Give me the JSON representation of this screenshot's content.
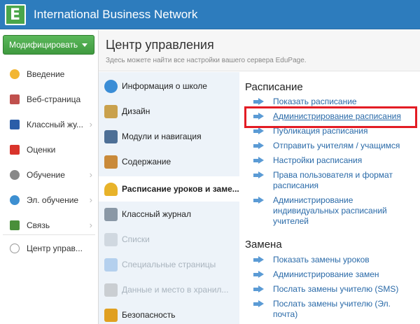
{
  "app": {
    "logo_letter": "E",
    "title": "International Business Network"
  },
  "sidebar": {
    "modify_button": "Модифицировать",
    "items": [
      {
        "label": "Введение",
        "icon": "star-icon",
        "has_submenu": false
      },
      {
        "label": "Веб-страница",
        "icon": "house-icon",
        "has_submenu": false
      },
      {
        "label": "Классный жу...",
        "icon": "journal-icon",
        "has_submenu": true
      },
      {
        "label": "Оценки",
        "icon": "grades-icon",
        "has_submenu": false
      },
      {
        "label": "Обучение",
        "icon": "gear-icon",
        "has_submenu": true
      },
      {
        "label": "Эл. обучение",
        "icon": "globe-icon",
        "has_submenu": true
      },
      {
        "label": "Связь",
        "icon": "envelope-icon",
        "has_submenu": true
      },
      {
        "label": "Центр управ...",
        "icon": "control-center-icon",
        "has_submenu": false
      }
    ]
  },
  "header": {
    "title": "Центр управления",
    "subtitle": "Здесь можете найти все настройки вашего сервера EduPage."
  },
  "categories": [
    {
      "label": "Информация о школе",
      "icon": "globe-info-icon",
      "state": "normal"
    },
    {
      "label": "Дизайн",
      "icon": "palette-icon",
      "state": "normal"
    },
    {
      "label": "Модули и навигация",
      "icon": "modules-icon",
      "state": "normal"
    },
    {
      "label": "Содержание",
      "icon": "content-icon",
      "state": "normal"
    },
    {
      "label": "Расписание уроков и заме...",
      "icon": "bell-icon",
      "state": "active"
    },
    {
      "label": "Классный журнал",
      "icon": "notebook-icon",
      "state": "normal"
    },
    {
      "label": "Списки",
      "icon": "list-icon",
      "state": "disabled"
    },
    {
      "label": "Специальные страницы",
      "icon": "cube-icon",
      "state": "disabled"
    },
    {
      "label": "Данные и место в хранил...",
      "icon": "storage-icon",
      "state": "disabled"
    },
    {
      "label": "Безопасность",
      "icon": "shield-icon",
      "state": "normal"
    }
  ],
  "schedule_section": {
    "title": "Расписание",
    "links": [
      "Показать расписание",
      "Администрирование расписания",
      "Публикация расписания",
      "Отправить учителям / учащимся",
      "Настройки расписания",
      "Права пользователя и формат расписания",
      "Администрирование индивидуальных расписаний учителей"
    ]
  },
  "substitution_section": {
    "title": "Замена",
    "links": [
      "Показать замены уроков",
      "Администрирование замен",
      "Послать замены учителю (SMS)",
      "Послать замены учителю (Эл. почта)"
    ]
  },
  "colors": {
    "topbar": "#2d7cbd",
    "modify_button": "#4aa64a",
    "link": "#2a6aa8",
    "highlight": "#e31c24",
    "category_bg": "#edf3f9"
  }
}
